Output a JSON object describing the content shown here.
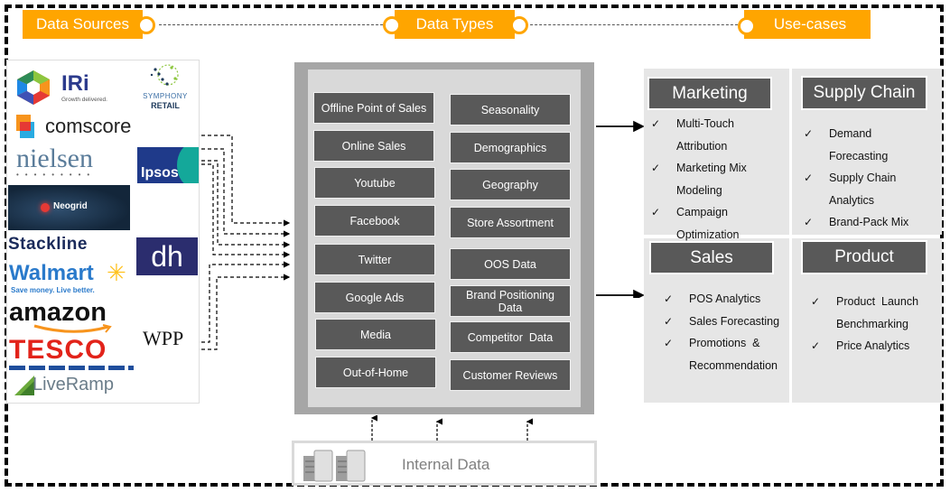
{
  "headers": {
    "data_sources": "Data Sources",
    "data_types": "Data Types",
    "use_cases": "Use-cases"
  },
  "logos": {
    "iri": "IRi",
    "iri_tagline": "Growth delivered.",
    "symphony_top": "SYMPHONY",
    "symphony_bottom": "RETAIL",
    "comscore": "comscore",
    "nielsen": "nielsen",
    "ipsos": "Ipsos",
    "neogrid": "Neogrid",
    "stackline": "Stackline",
    "dh": "dh",
    "walmart": "Walmart",
    "walmart_tagline": "Save money. Live better.",
    "amazon": "amazon",
    "tesco": "TESCO",
    "wpp": "WPP",
    "liveramp": "LiveRamp"
  },
  "data_types": {
    "left": [
      "Offline Point of Sales",
      "Online Sales",
      "Youtube",
      "Facebook",
      "Twitter",
      "Google Ads",
      "Media",
      "Out-of-Home"
    ],
    "right": [
      "Seasonality",
      "Demographics",
      "Geography",
      "Store Assortment",
      "OOS Data",
      "Brand Positioning Data",
      "Competitor  Data",
      "Customer Reviews"
    ]
  },
  "internal_data": {
    "label": "Internal Data",
    "icon": "server-icon"
  },
  "use_cases": {
    "marketing": {
      "title": "Marketing",
      "items": [
        "Multi-Touch",
        "Attribution",
        "Marketing Mix",
        "Modeling",
        "Campaign",
        "Optimization"
      ],
      "checks": [
        true,
        false,
        true,
        false,
        true,
        false
      ]
    },
    "supply_chain": {
      "title": "Supply Chain",
      "items": [
        "Demand",
        "Forecasting",
        "Supply Chain",
        "Analytics",
        "Brand-Pack Mix"
      ],
      "checks": [
        true,
        false,
        true,
        false,
        true
      ]
    },
    "sales": {
      "title": "Sales",
      "items": [
        "POS Analytics",
        "Sales Forecasting",
        "Promotions  &",
        "Recommendation"
      ],
      "checks": [
        true,
        true,
        true,
        false
      ]
    },
    "product": {
      "title": "Product",
      "items": [
        "Product  Launch",
        "Benchmarking",
        "Price Analytics"
      ],
      "checks": [
        true,
        false,
        true
      ]
    },
    "check_glyph": "✓"
  },
  "colors": {
    "accent_orange": "#FFA500",
    "tile_dark": "#595959",
    "panel_light": "#E6E6E6",
    "outer_gray": "#A6A6A6",
    "inner_gray": "#D9D9D9"
  }
}
